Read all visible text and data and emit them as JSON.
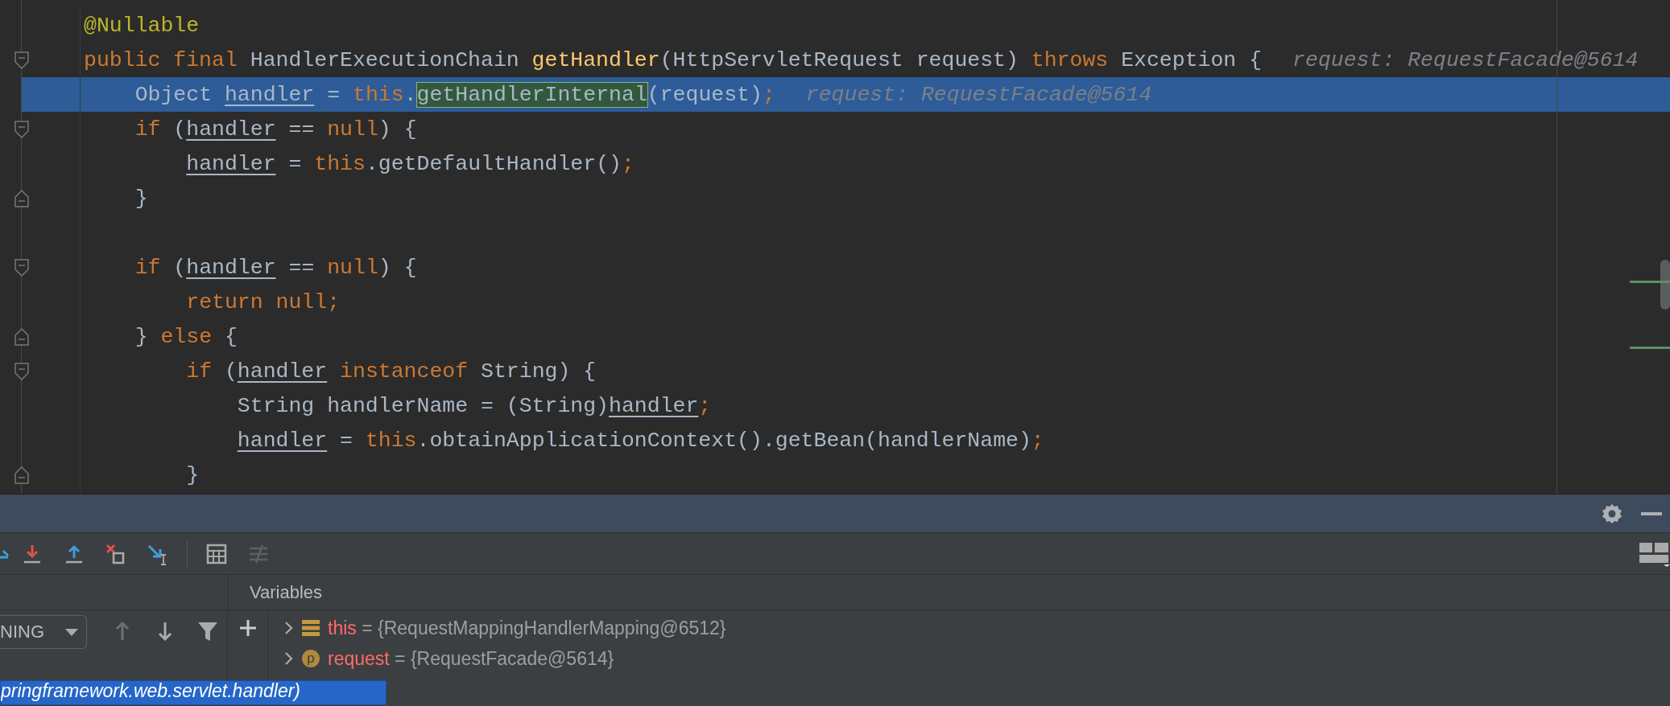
{
  "editor": {
    "lines": [
      {
        "selected": false,
        "tokens": [
          {
            "kind": "annotation",
            "text": "@Nullable"
          }
        ]
      },
      {
        "selected": false,
        "fold_start": true,
        "tokens": [
          {
            "kind": "keyword",
            "text": "public final "
          },
          {
            "kind": "plain",
            "text": "HandlerExecutionChain "
          },
          {
            "kind": "method",
            "text": "getHandler"
          },
          {
            "kind": "plain",
            "text": "(HttpServletRequest request) "
          },
          {
            "kind": "keyword",
            "text": "throws "
          },
          {
            "kind": "plain",
            "text": "Exception {"
          }
        ],
        "hint": "request: RequestFacade@5614"
      },
      {
        "selected": true,
        "tokens": [
          {
            "kind": "plain",
            "text": "    Object "
          },
          {
            "kind": "var",
            "text": "handler"
          },
          {
            "kind": "plain",
            "text": " = "
          },
          {
            "kind": "keyword",
            "text": "this"
          },
          {
            "kind": "plain",
            "text": "."
          },
          {
            "kind": "boxed",
            "text": "getHandlerInternal"
          },
          {
            "kind": "plain",
            "text": "(request)"
          },
          {
            "kind": "keyword",
            "text": ";"
          }
        ],
        "hint": "request: RequestFacade@5614"
      },
      {
        "selected": false,
        "fold_start": true,
        "tokens": [
          {
            "kind": "keyword",
            "text": "    if "
          },
          {
            "kind": "plain",
            "text": "("
          },
          {
            "kind": "var",
            "text": "handler"
          },
          {
            "kind": "plain",
            "text": " == "
          },
          {
            "kind": "keyword",
            "text": "null"
          },
          {
            "kind": "plain",
            "text": ") {"
          }
        ]
      },
      {
        "selected": false,
        "tokens": [
          {
            "kind": "var",
            "text": "        handler"
          },
          {
            "kind": "plain",
            "text": " = "
          },
          {
            "kind": "keyword",
            "text": "this"
          },
          {
            "kind": "plain",
            "text": ".getDefaultHandler()"
          },
          {
            "kind": "keyword",
            "text": ";"
          }
        ]
      },
      {
        "selected": false,
        "fold_end": true,
        "tokens": [
          {
            "kind": "plain",
            "text": "    }"
          }
        ]
      },
      {
        "selected": false
      },
      {
        "selected": false,
        "fold_start": true,
        "tokens": [
          {
            "kind": "keyword",
            "text": "    if "
          },
          {
            "kind": "plain",
            "text": "("
          },
          {
            "kind": "var",
            "text": "handler"
          },
          {
            "kind": "plain",
            "text": " == "
          },
          {
            "kind": "keyword",
            "text": "null"
          },
          {
            "kind": "plain",
            "text": ") {"
          }
        ]
      },
      {
        "selected": false,
        "tokens": [
          {
            "kind": "keyword",
            "text": "        return null;"
          }
        ]
      },
      {
        "selected": false,
        "fold_end": true,
        "tokens": [
          {
            "kind": "plain",
            "text": "    } "
          },
          {
            "kind": "keyword",
            "text": "else "
          },
          {
            "kind": "plain",
            "text": "{"
          }
        ]
      },
      {
        "selected": false,
        "fold_start": true,
        "tokens": [
          {
            "kind": "keyword",
            "text": "        if "
          },
          {
            "kind": "plain",
            "text": "("
          },
          {
            "kind": "var",
            "text": "handler"
          },
          {
            "kind": "keyword",
            "text": " instanceof "
          },
          {
            "kind": "plain",
            "text": "String) {"
          }
        ]
      },
      {
        "selected": false,
        "tokens": [
          {
            "kind": "plain",
            "text": "            String handlerName = (String)"
          },
          {
            "kind": "var",
            "text": "handler"
          },
          {
            "kind": "keyword",
            "text": ";"
          }
        ]
      },
      {
        "selected": false,
        "tokens": [
          {
            "kind": "var",
            "text": "            handler"
          },
          {
            "kind": "plain",
            "text": " = "
          },
          {
            "kind": "keyword",
            "text": "this"
          },
          {
            "kind": "plain",
            "text": ".obtainApplicationContext().getBean(handlerName)"
          },
          {
            "kind": "keyword",
            "text": ";"
          }
        ]
      },
      {
        "selected": false,
        "fold_end": true,
        "tokens": [
          {
            "kind": "plain",
            "text": "        }"
          }
        ]
      }
    ]
  },
  "debugger": {
    "toolbar": [
      {
        "kind": "step_over",
        "disabled": false
      },
      {
        "kind": "step_into",
        "disabled": false
      },
      {
        "kind": "step_out",
        "disabled": false
      },
      {
        "kind": "drop_frame",
        "disabled": false
      },
      {
        "kind": "run_to_cursor",
        "disabled": false
      },
      {
        "kind": "evaluate",
        "disabled": false
      },
      {
        "kind": "trace",
        "disabled": true
      }
    ],
    "thread_dropdown": {
      "value": "NING"
    },
    "frame_controls": [
      {
        "kind": "up",
        "disabled": true
      },
      {
        "kind": "down",
        "disabled": false
      },
      {
        "kind": "filter",
        "disabled": false
      }
    ],
    "variables_title": "Variables",
    "variables": [
      {
        "kind": "field",
        "name": "this",
        "value": "= {RequestMappingHandlerMapping@6512}"
      },
      {
        "kind": "parameter",
        "name": "request",
        "value": "= {RequestFacade@5614}",
        "badge": "p"
      }
    ],
    "frame_tooltip": "pringframework.web.servlet.handler)"
  }
}
